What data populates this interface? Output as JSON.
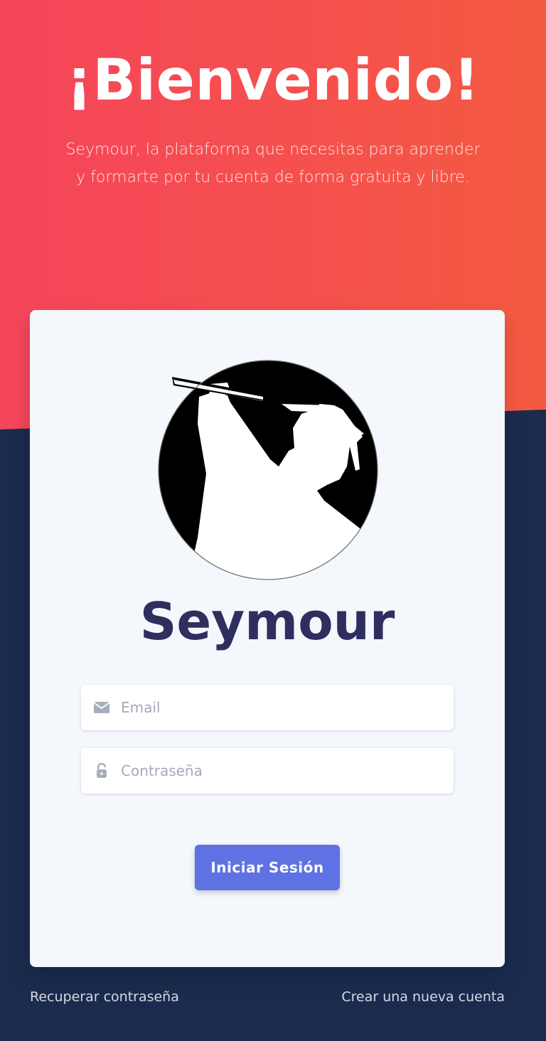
{
  "hero": {
    "title": "¡Bienvenido!",
    "subtitle": "Seymour, la plataforma que necesitas para aprender y formarte por tu cuenta de forma gratuita y libre."
  },
  "card": {
    "brand_name": "Seymour",
    "email": {
      "placeholder": "Email",
      "value": "",
      "icon": "envelope-icon"
    },
    "password": {
      "placeholder": "Contraseña",
      "value": "",
      "icon": "unlock-icon"
    },
    "login_label": "Iniciar Sesión"
  },
  "footer": {
    "recover_label": "Recuperar contraseña",
    "register_label": "Crear una nueva cuenta"
  },
  "colors": {
    "hero_gradient_start": "#f5455a",
    "hero_gradient_end": "#f45a41",
    "background": "#1b2b4d",
    "card": "#f4f7fb",
    "brand_text": "#2e2f5e",
    "primary_button": "#5e72e4"
  }
}
